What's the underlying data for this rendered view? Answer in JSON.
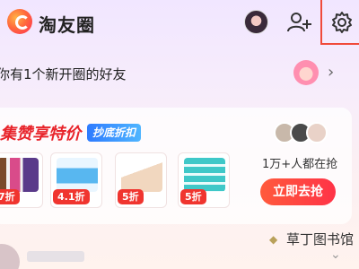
{
  "header": {
    "app_title": "淘友圈",
    "icons": {
      "logo": "app-logo",
      "avatar": "user-avatar",
      "add_friend": "add-friend-icon",
      "settings": "gear-icon"
    }
  },
  "notice": {
    "text": "你有1个新开圈的好友",
    "chevron": "›"
  },
  "deal": {
    "title": "集赞享特价",
    "tag": "抄底折扣",
    "products": [
      {
        "discount": "7折",
        "icon": "shampoo-bottles"
      },
      {
        "discount": "4.1折",
        "icon": "wet-wipes"
      },
      {
        "discount": "5折",
        "icon": "tissue-box"
      },
      {
        "discount": "5折",
        "icon": "tissue-pack"
      }
    ],
    "grab_count_text": "1万+人都在抢",
    "grab_button": "立即去抢"
  },
  "feed": {
    "chevron": "⌄"
  },
  "watermark": {
    "text": "草丁图书馆"
  },
  "colors": {
    "accent": "#f0352f",
    "tag_blue": "#2e7bff",
    "title_red": "#e8242b"
  }
}
